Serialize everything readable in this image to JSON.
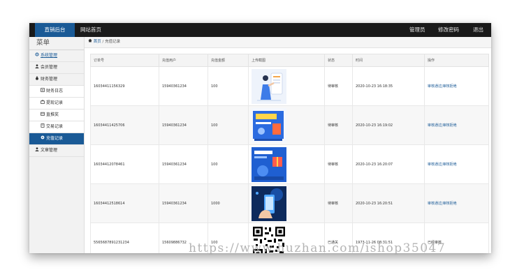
{
  "topbar": {
    "brand": "直销后台",
    "nav_home": "网站首页",
    "admin": "管理员",
    "change_password": "修改密码",
    "logout": "退出"
  },
  "sidebar": {
    "title": "菜单",
    "items": [
      {
        "label": "系统管理",
        "icon": "gear-icon"
      },
      {
        "label": "会员管理",
        "icon": "user-icon"
      },
      {
        "label": "财务管理",
        "icon": "money-icon"
      },
      {
        "label": "财务日志",
        "icon": "log-icon"
      },
      {
        "label": "提现记录",
        "icon": "withdraw-icon"
      },
      {
        "label": "直推奖",
        "icon": "reward-icon"
      },
      {
        "label": "交易记录",
        "icon": "trade-icon"
      },
      {
        "label": "充值记录",
        "icon": "recharge-icon"
      },
      {
        "label": "文章管理",
        "icon": "article-icon"
      }
    ]
  },
  "breadcrumb": {
    "home": "首页",
    "separator": "/",
    "current": "充值记录"
  },
  "table": {
    "headers": [
      "订单号",
      "充值用户",
      "充值金额",
      "上传截图",
      "状态",
      "时间",
      "操作"
    ],
    "rows": [
      {
        "order": "16034411156329",
        "user": "15940361234",
        "amount": "100",
        "image": "illustration-person-with-papers",
        "status": "待审核",
        "time": "2020-10-23 16:18:35",
        "action": "审核通过|审核拒绝"
      },
      {
        "order": "16034411425706",
        "user": "15940361234",
        "amount": "100",
        "image": "banner-promo-blue",
        "status": "待审核",
        "time": "2020-10-23 16:19:02",
        "action": "审核通过|审核拒绝"
      },
      {
        "order": "16034412078461",
        "user": "15940361234",
        "amount": "100",
        "image": "banner-gift-blue",
        "status": "待审核",
        "time": "2020-10-23 16:20:07",
        "action": "审核通过|审核拒绝"
      },
      {
        "order": "16034412518614",
        "user": "15940361234",
        "amount": "1000",
        "image": "phone-hand-blue",
        "status": "待审核",
        "time": "2020-10-23 16:20:51",
        "action": "审核通过|审核拒绝"
      },
      {
        "order": "5565687891231234",
        "user": "15609886732",
        "amount": "100",
        "image": "qr-code",
        "status": "已通关",
        "time": "1973-11-26 08:31:51",
        "action": "已经审核"
      }
    ]
  },
  "watermark": "https://www.huzhan.com/ishop35047",
  "colors": {
    "accent": "#1a5a96",
    "topbar": "#1a1a1a"
  }
}
